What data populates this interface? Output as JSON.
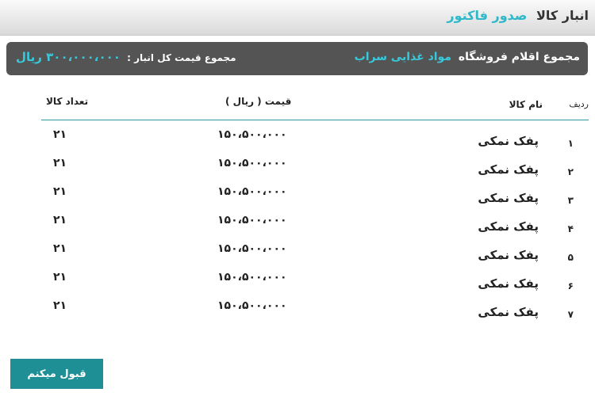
{
  "header": {
    "root": "انبار کالا",
    "current": "صدور فاکتور"
  },
  "summary": {
    "store_label": "مجموع اقلام فروشگاه",
    "store_name": "مواد غذایی سراب",
    "total_label": "مجموع قیمت کل انبار :",
    "total_value": "۳۰۰،۰۰۰،۰۰۰ ریال"
  },
  "table": {
    "headers": {
      "row": "ردیف",
      "name": "نام کالا",
      "price": "قیمت ( ریال )",
      "qty": "تعداد کالا"
    },
    "rows": [
      {
        "idx": "۱",
        "name": "پفک نمکی",
        "price": "۱۵۰،۵۰۰،۰۰۰",
        "qty": "۲۱"
      },
      {
        "idx": "۲",
        "name": "پفک نمکی",
        "price": "۱۵۰،۵۰۰،۰۰۰",
        "qty": "۲۱"
      },
      {
        "idx": "۳",
        "name": "پفک نمکی",
        "price": "۱۵۰،۵۰۰،۰۰۰",
        "qty": "۲۱"
      },
      {
        "idx": "۴",
        "name": "پفک نمکی",
        "price": "۱۵۰،۵۰۰،۰۰۰",
        "qty": "۲۱"
      },
      {
        "idx": "۵",
        "name": "پفک نمکی",
        "price": "۱۵۰،۵۰۰،۰۰۰",
        "qty": "۲۱"
      },
      {
        "idx": "۶",
        "name": "پفک نمکی",
        "price": "۱۵۰،۵۰۰،۰۰۰",
        "qty": "۲۱"
      },
      {
        "idx": "۷",
        "name": "پفک نمکی",
        "price": "۱۵۰،۵۰۰،۰۰۰",
        "qty": "۲۱"
      }
    ]
  },
  "actions": {
    "accept_label": "قبول میکنم"
  },
  "colors": {
    "accent": "#38c9db",
    "button": "#1f8f96",
    "summary_bg": "#545454"
  }
}
